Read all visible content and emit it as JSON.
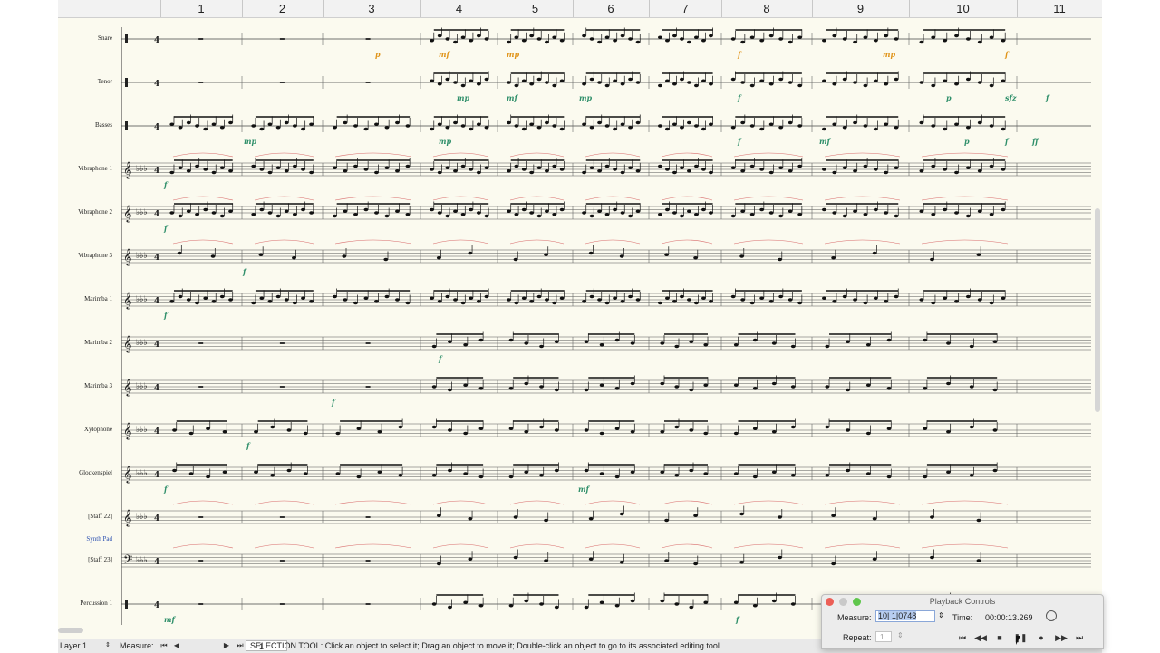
{
  "measure_numbers": [
    "1",
    "2",
    "3",
    "4",
    "5",
    "6",
    "7",
    "8",
    "9",
    "10",
    "11"
  ],
  "staves": [
    {
      "name": "Snare",
      "kind": "perc"
    },
    {
      "name": "Tenor",
      "kind": "perc"
    },
    {
      "name": "Basses",
      "kind": "perc"
    },
    {
      "name": "Vibraphone 1",
      "kind": "treble"
    },
    {
      "name": "Vibraphone 2",
      "kind": "treble"
    },
    {
      "name": "Vibraphone 3",
      "kind": "treble"
    },
    {
      "name": "Marimba 1",
      "kind": "treble"
    },
    {
      "name": "Marimba 2",
      "kind": "treble"
    },
    {
      "name": "Marimba 3",
      "kind": "treble"
    },
    {
      "name": "Xylophone",
      "kind": "treble"
    },
    {
      "name": "Glockenspiel",
      "kind": "treble"
    },
    {
      "name": "[Staff 22]",
      "kind": "treble"
    },
    {
      "name": "[Staff 23]",
      "kind": "bass"
    },
    {
      "name": "Percussion 1",
      "kind": "perc"
    }
  ],
  "group_label": "Synth Pad",
  "dynamics": {
    "snare": [
      "p",
      "mf",
      "mp",
      "f",
      "mp",
      "f"
    ],
    "tenor": [
      "mp",
      "mf",
      "mp",
      "f",
      "p",
      "sfz",
      "f"
    ],
    "basses": [
      "mp",
      "mp",
      "f",
      "mf",
      "p",
      "f",
      "ff"
    ],
    "vib1": [
      "f"
    ],
    "vib2": [
      "f"
    ],
    "vib3": [
      "f"
    ],
    "mar1": [
      "f"
    ],
    "mar2": [
      "f"
    ],
    "mar3": [
      "f"
    ],
    "xylo": [
      "f"
    ],
    "glock": [
      "f",
      "mf"
    ],
    "perc1": [
      "mf",
      "f"
    ]
  },
  "status_bar": {
    "layer": "Layer 1",
    "measure_label": "Measure:",
    "measure_value": "1",
    "message": "SELECTION TOOL: Click an object to select it; Drag an object to move it; Double-click an object to go to its associated editing tool"
  },
  "playback": {
    "title": "Playback Controls",
    "measure_label": "Measure:",
    "measure_value": "10| 1|0748",
    "time_label": "Time:",
    "time_value": "00:00:13.269",
    "repeat_label": "Repeat:",
    "repeat_value": "1"
  },
  "icons": [
    "first-measure-icon",
    "prev-measure-icon",
    "next-measure-icon",
    "last-measure-icon",
    "rewind-icon",
    "stop-icon",
    "pause-icon",
    "record-icon",
    "fast-forward-icon",
    "skip-end-icon",
    "clock-icon"
  ],
  "colors": {
    "paper": "#fbfaef",
    "dynamic": "#2f8f6a",
    "dynamic_alt": "#e0941a",
    "slur": "#d86a6a"
  }
}
